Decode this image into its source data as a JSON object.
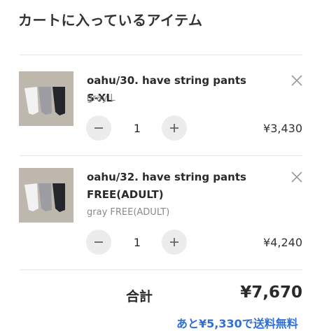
{
  "cart": {
    "title": "カートに入っているアイテム",
    "items": [
      {
        "name": "oahu/30. have string pants S-XL",
        "variant": "gray L",
        "quantity": "1",
        "price": "¥3,430",
        "image_icon": "pants-product-image"
      },
      {
        "name": "oahu/32. have string pants FREE(ADULT)",
        "variant": "gray FREE(ADULT)",
        "quantity": "1",
        "price": "¥4,240",
        "image_icon": "pants-product-image"
      }
    ],
    "total_label": "合計",
    "total_value": "¥7,670",
    "shipping_note": "あと¥5,330で送料無料"
  },
  "colors": {
    "accent_link": "#2f6fd6",
    "button_bg": "#ececec",
    "text_primary": "#2a2a2a",
    "text_secondary": "#8a8a8a"
  }
}
